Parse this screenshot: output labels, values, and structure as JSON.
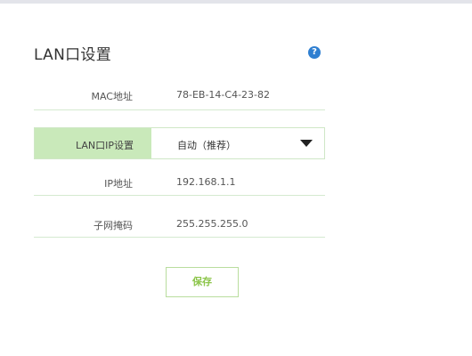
{
  "page": {
    "title": "LAN口设置",
    "help_icon": "?"
  },
  "fields": {
    "mac": {
      "label": "MAC地址",
      "value": "78-EB-14-C4-23-82"
    },
    "ip_setting": {
      "label": "LAN口IP设置",
      "selected": "自动（推荐）"
    },
    "ip": {
      "label": "IP地址",
      "value": "192.168.1.1"
    },
    "mask": {
      "label": "子网掩码",
      "value": "255.255.255.0"
    }
  },
  "actions": {
    "save_label": "保存"
  },
  "colors": {
    "accent_green": "#8cc54a",
    "label_bg": "#c9e9ba",
    "help_blue": "#2f7fd1"
  },
  "icons": {
    "help": "question-mark-icon",
    "dropdown": "caret-down-icon"
  }
}
